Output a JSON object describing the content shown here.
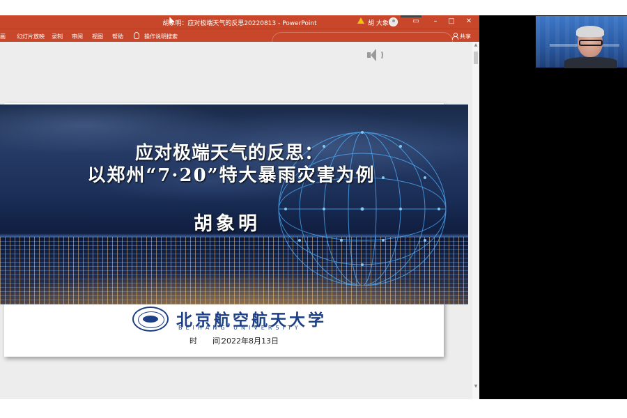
{
  "window": {
    "title": "胡象明：应对极端天气的反思20220813",
    "app_name": "PowerPoint",
    "user_name": "胡 大象",
    "controls": {
      "minimize": "–",
      "maximize": "□",
      "close": "✕"
    }
  },
  "ribbon": {
    "tabs": [
      "画",
      "幻灯片放映",
      "录制",
      "审阅",
      "视图",
      "帮助",
      "操作说明搜索"
    ],
    "share_label": "共享"
  },
  "slide": {
    "title_line1": "应对极端天气的反思：",
    "title_line2": "以郑州“7·20”特大暴雨灾害为例",
    "author": "胡象明",
    "logo_cn": "北京航空航天大学",
    "logo_en": "BEIHANG UNIVERSITY",
    "date_label_a": "时",
    "date_label_b": "间：",
    "date_value": "2022年8月13日"
  },
  "colors": {
    "titlebar": "#c8472a",
    "brand_blue": "#1d3f86",
    "panel": "#000000"
  },
  "icons": [
    "warning-icon",
    "avatar",
    "lightbulb-icon",
    "share-icon",
    "speaker-icon",
    "beihang-seal-logo"
  ]
}
